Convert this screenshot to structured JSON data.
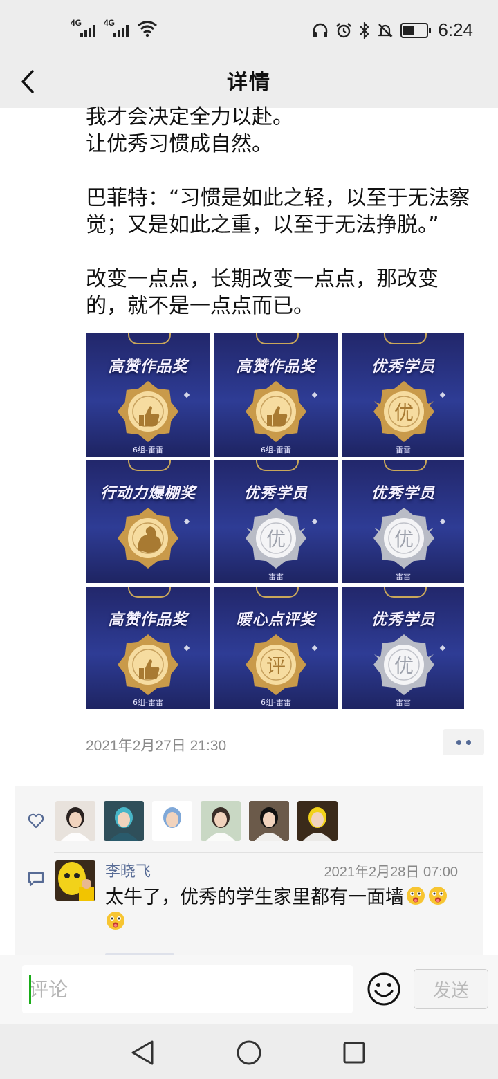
{
  "status_bar": {
    "signal_1_label": "4G",
    "signal_2_label": "4G",
    "time": "6:24",
    "battery_level": 0.45,
    "icons": [
      "headphones-icon",
      "alarm-icon",
      "bluetooth-icon",
      "mute-icon",
      "battery-icon"
    ]
  },
  "nav": {
    "title": "详情",
    "back_icon": "chevron-left-icon"
  },
  "post": {
    "text_lines": [
      "我才会决定全力以赴。",
      "让优秀习惯成自然。",
      "",
      "巴菲特：“习惯是如此之轻，以至于无法察",
      "觉；又是如此之重，以至于无法挣脱。”",
      "",
      "改变一点点，长期改变一点点，那改变",
      "的，就不是一点点而已。"
    ],
    "images": [
      {
        "title": "高赞作品奖",
        "owner": "6组-雷雷",
        "badge": "gold",
        "glyph": "thumb"
      },
      {
        "title": "高赞作品奖",
        "owner": "6组-雷雷",
        "badge": "gold",
        "glyph": "thumb"
      },
      {
        "title": "优秀学员",
        "owner": "雷雷",
        "badge": "gold-wing",
        "glyph": "优"
      },
      {
        "title": "行动力爆棚奖",
        "owner": "",
        "badge": "gold",
        "glyph": "arm"
      },
      {
        "title": "优秀学员",
        "owner": "雷雷",
        "badge": "silver-wing",
        "glyph": "优"
      },
      {
        "title": "优秀学员",
        "owner": "雷雷",
        "badge": "silver-wing",
        "glyph": "优"
      },
      {
        "title": "高赞作品奖",
        "owner": "6组-雷雷",
        "badge": "gold",
        "glyph": "thumb"
      },
      {
        "title": "暖心点评奖",
        "owner": "6组-雷雷",
        "badge": "gold",
        "glyph": "评"
      },
      {
        "title": "优秀学员",
        "owner": "雷雷",
        "badge": "silver-wing",
        "glyph": "优"
      }
    ],
    "timestamp": "2021年2月27日 21:30"
  },
  "likes": {
    "icon": "heart-icon",
    "avatars": [
      {
        "bg": "#e8e2dc",
        "hair": "#2a2220"
      },
      {
        "bg": "#2f4f5a",
        "hair": "#48b6c8"
      },
      {
        "bg": "#ffffff",
        "hair": "#7fa8d8"
      },
      {
        "bg": "#c9d8c4",
        "hair": "#3a2e28"
      },
      {
        "bg": "#6b5a4a",
        "hair": "#111111"
      },
      {
        "bg": "#3a2a1a",
        "hair": "#f2d21a"
      }
    ]
  },
  "comment": {
    "icon": "comment-icon",
    "name": "李晓飞",
    "time": "2021年2月28日 07:00",
    "text": "太牛了，优秀的学生家里都有一面墙"
  },
  "input": {
    "placeholder": "评论",
    "send_label": "发送",
    "emoji_icon": "smiley-icon"
  },
  "system_nav": [
    "back-triangle-icon",
    "home-circle-icon",
    "recents-square-icon"
  ]
}
